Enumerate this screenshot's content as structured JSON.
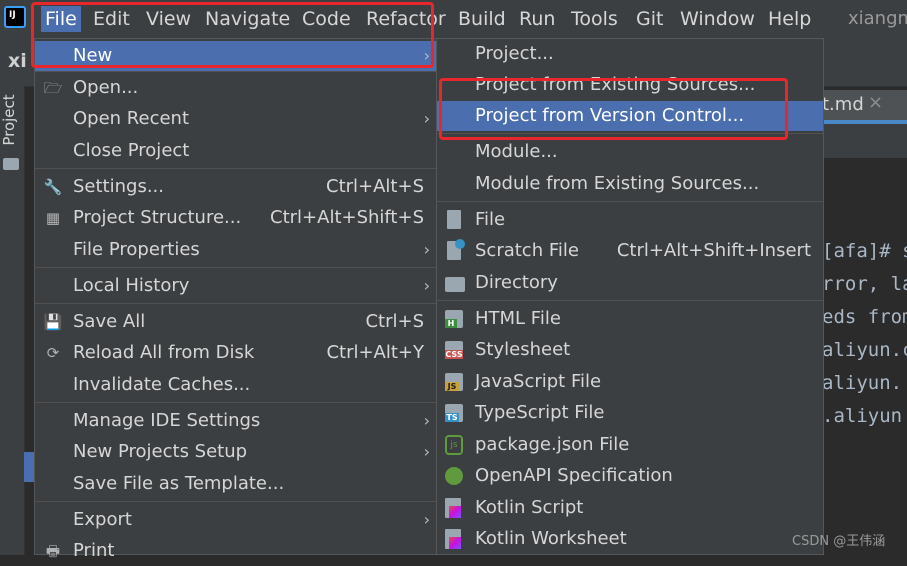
{
  "menubar": {
    "items": [
      "File",
      "Edit",
      "View",
      "Navigate",
      "Code",
      "Refactor",
      "Build",
      "Run",
      "Tools",
      "Git",
      "Window",
      "Help"
    ],
    "user": "xiangm"
  },
  "window": {
    "project_label": "xi",
    "side_project": "Project",
    "editor_tab": "t.md",
    "editor_tab_close": "×",
    "code_lines": [
      "[afa]# su",
      "rror, la",
      "eds from",
      "aliyun.co",
      "aliyun.",
      ".aliyun"
    ]
  },
  "file_menu": {
    "items": [
      {
        "label": "New",
        "shortcut": "",
        "submenu": true
      },
      {
        "label": "Open...",
        "shortcut": "",
        "submenu": false
      },
      {
        "label": "Open Recent",
        "shortcut": "",
        "submenu": true
      },
      {
        "label": "Close Project",
        "shortcut": "",
        "submenu": false
      },
      {
        "label": "Settings...",
        "shortcut": "Ctrl+Alt+S",
        "submenu": false
      },
      {
        "label": "Project Structure...",
        "shortcut": "Ctrl+Alt+Shift+S",
        "submenu": false
      },
      {
        "label": "File Properties",
        "shortcut": "",
        "submenu": true
      },
      {
        "label": "Local History",
        "shortcut": "",
        "submenu": true
      },
      {
        "label": "Save All",
        "shortcut": "Ctrl+S",
        "submenu": false
      },
      {
        "label": "Reload All from Disk",
        "shortcut": "Ctrl+Alt+Y",
        "submenu": false
      },
      {
        "label": "Invalidate Caches...",
        "shortcut": "",
        "submenu": false
      },
      {
        "label": "Manage IDE Settings",
        "shortcut": "",
        "submenu": true
      },
      {
        "label": "New Projects Setup",
        "shortcut": "",
        "submenu": true
      },
      {
        "label": "Save File as Template...",
        "shortcut": "",
        "submenu": false
      },
      {
        "label": "Export",
        "shortcut": "",
        "submenu": true
      },
      {
        "label": "Print",
        "shortcut": "",
        "submenu": false
      }
    ]
  },
  "new_menu": {
    "items": [
      {
        "label": "Project...",
        "shortcut": ""
      },
      {
        "label": "Project from Existing Sources...",
        "shortcut": ""
      },
      {
        "label": "Project from Version Control...",
        "shortcut": ""
      },
      {
        "label": "Module...",
        "shortcut": ""
      },
      {
        "label": "Module from Existing Sources...",
        "shortcut": ""
      },
      {
        "label": "File",
        "shortcut": ""
      },
      {
        "label": "Scratch File",
        "shortcut": "Ctrl+Alt+Shift+Insert"
      },
      {
        "label": "Directory",
        "shortcut": ""
      },
      {
        "label": "HTML File",
        "shortcut": ""
      },
      {
        "label": "Stylesheet",
        "shortcut": ""
      },
      {
        "label": "JavaScript File",
        "shortcut": ""
      },
      {
        "label": "TypeScript File",
        "shortcut": ""
      },
      {
        "label": "package.json File",
        "shortcut": ""
      },
      {
        "label": "OpenAPI Specification",
        "shortcut": ""
      },
      {
        "label": "Kotlin Script",
        "shortcut": ""
      },
      {
        "label": "Kotlin Worksheet",
        "shortcut": ""
      }
    ]
  },
  "icons": {
    "html_badge": "H",
    "css_badge": "CSS",
    "js_badge": "JS",
    "ts_badge": "TS",
    "package_badge": "js"
  },
  "colors": {
    "selection": "#4b6eaf",
    "highlight_box": "#e8272d",
    "menu_bg": "#3c3f41"
  },
  "watermark": "CSDN @王伟涵"
}
